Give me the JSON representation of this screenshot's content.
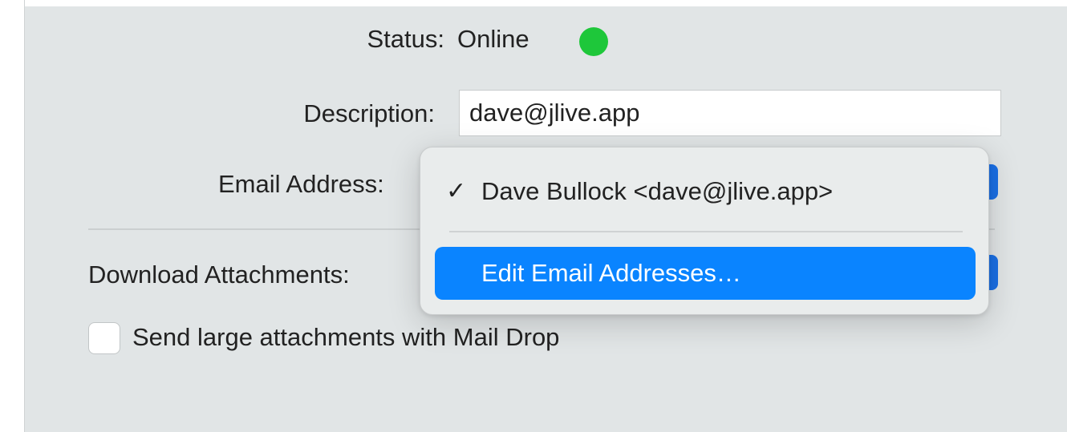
{
  "form": {
    "status_label": "Status:",
    "status_value": "Online",
    "status_color": "#1ec73a",
    "description_label": "Description:",
    "description_value": "dave@jlive.app",
    "email_label": "Email Address:",
    "download_label": "Download Attachments:",
    "maildrop_label": "Send large attachments with Mail Drop",
    "maildrop_checked": false
  },
  "email_menu": {
    "items": [
      {
        "label": "Dave Bullock <dave@jlive.app>",
        "checked": true,
        "check_glyph": "✓"
      },
      {
        "label": "Edit Email Addresses…",
        "highlighted": true
      }
    ],
    "highlight_color": "#0a84ff"
  }
}
